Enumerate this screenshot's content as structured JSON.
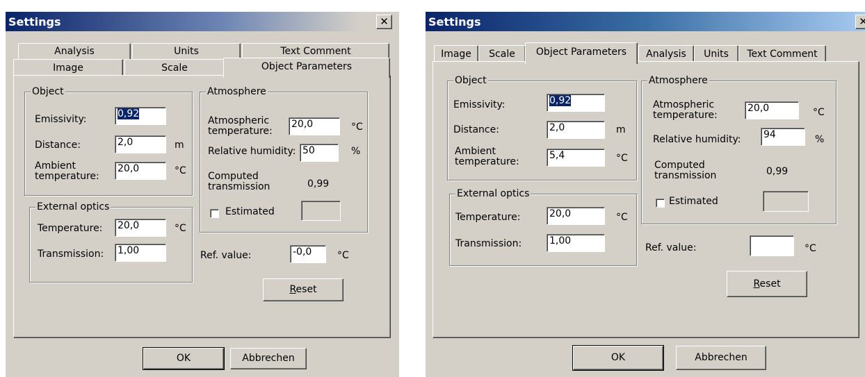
{
  "colors": {
    "titlebar_left": "#0a246a",
    "titlebar_right_old": "#d4d0c8",
    "titlebar_right_new": "#a6caf0",
    "face": "#d4d0c8",
    "selection": "#0a246a"
  },
  "icons": {
    "close": "close-icon"
  },
  "left_dialog": {
    "title": "Settings",
    "close_glyph": "✕",
    "tabs_row1": [
      "Analysis",
      "Units",
      "Text Comment"
    ],
    "tabs_row2": [
      "Image",
      "Scale",
      "Object Parameters"
    ],
    "active_tab": "Object Parameters",
    "object": {
      "title": "Object",
      "emissivity_label": "Emissivity:",
      "emissivity_value": "0,92",
      "distance_label": "Distance:",
      "distance_value": "2,0",
      "distance_unit": "m",
      "ambient_label": "Ambient temperature:",
      "ambient_value": "20,0",
      "ambient_unit": "°C"
    },
    "atmosphere": {
      "title": "Atmosphere",
      "atm_temp_label": "Atmospheric temperature:",
      "atm_temp_value": "20,0",
      "atm_temp_unit": "°C",
      "humidity_label": "Relative humidity:",
      "humidity_value": "50",
      "humidity_unit": "%",
      "transmission_label": "Computed transmission",
      "transmission_value": "0,99",
      "estimated_label": "Estimated",
      "estimated_value": ""
    },
    "external_optics": {
      "title": "External optics",
      "temperature_label": "Temperature:",
      "temperature_value": "20,0",
      "temperature_unit": "°C",
      "transmission_label": "Transmission:",
      "transmission_value": "1,00"
    },
    "ref_value_label": "Ref. value:",
    "ref_value": "-0,0",
    "ref_unit": "°C",
    "reset_label": "Reset",
    "ok_label": "OK",
    "cancel_label": "Abbrechen"
  },
  "right_dialog": {
    "title": "Settings",
    "close_glyph": "✕",
    "tabs": [
      "Image",
      "Scale",
      "Object Parameters",
      "Analysis",
      "Units",
      "Text Comment"
    ],
    "active_tab": "Object Parameters",
    "object": {
      "title": "Object",
      "emissivity_label": "Emissivity:",
      "emissivity_value": "0,92",
      "distance_label": "Distance:",
      "distance_value": "2,0",
      "distance_unit": "m",
      "ambient_label": "Ambient temperature:",
      "ambient_value": "5,4",
      "ambient_unit": "°C"
    },
    "atmosphere": {
      "title": "Atmosphere",
      "atm_temp_label": "Atmospheric temperature:",
      "atm_temp_value": "20,0",
      "atm_temp_unit": "°C",
      "humidity_label": "Relative humidity:",
      "humidity_value": "94",
      "humidity_unit": "%",
      "transmission_label": "Computed transmission",
      "transmission_value": "0,99",
      "estimated_label": "Estimated",
      "estimated_value": ""
    },
    "external_optics": {
      "title": "External optics",
      "temperature_label": "Temperature:",
      "temperature_value": "20,0",
      "temperature_unit": "°C",
      "transmission_label": "Transmission:",
      "transmission_value": "1,00"
    },
    "ref_value_label": "Ref. value:",
    "ref_value": "",
    "ref_unit": "°C",
    "reset_label": "Reset",
    "ok_label": "OK",
    "cancel_label": "Abbrechen"
  }
}
